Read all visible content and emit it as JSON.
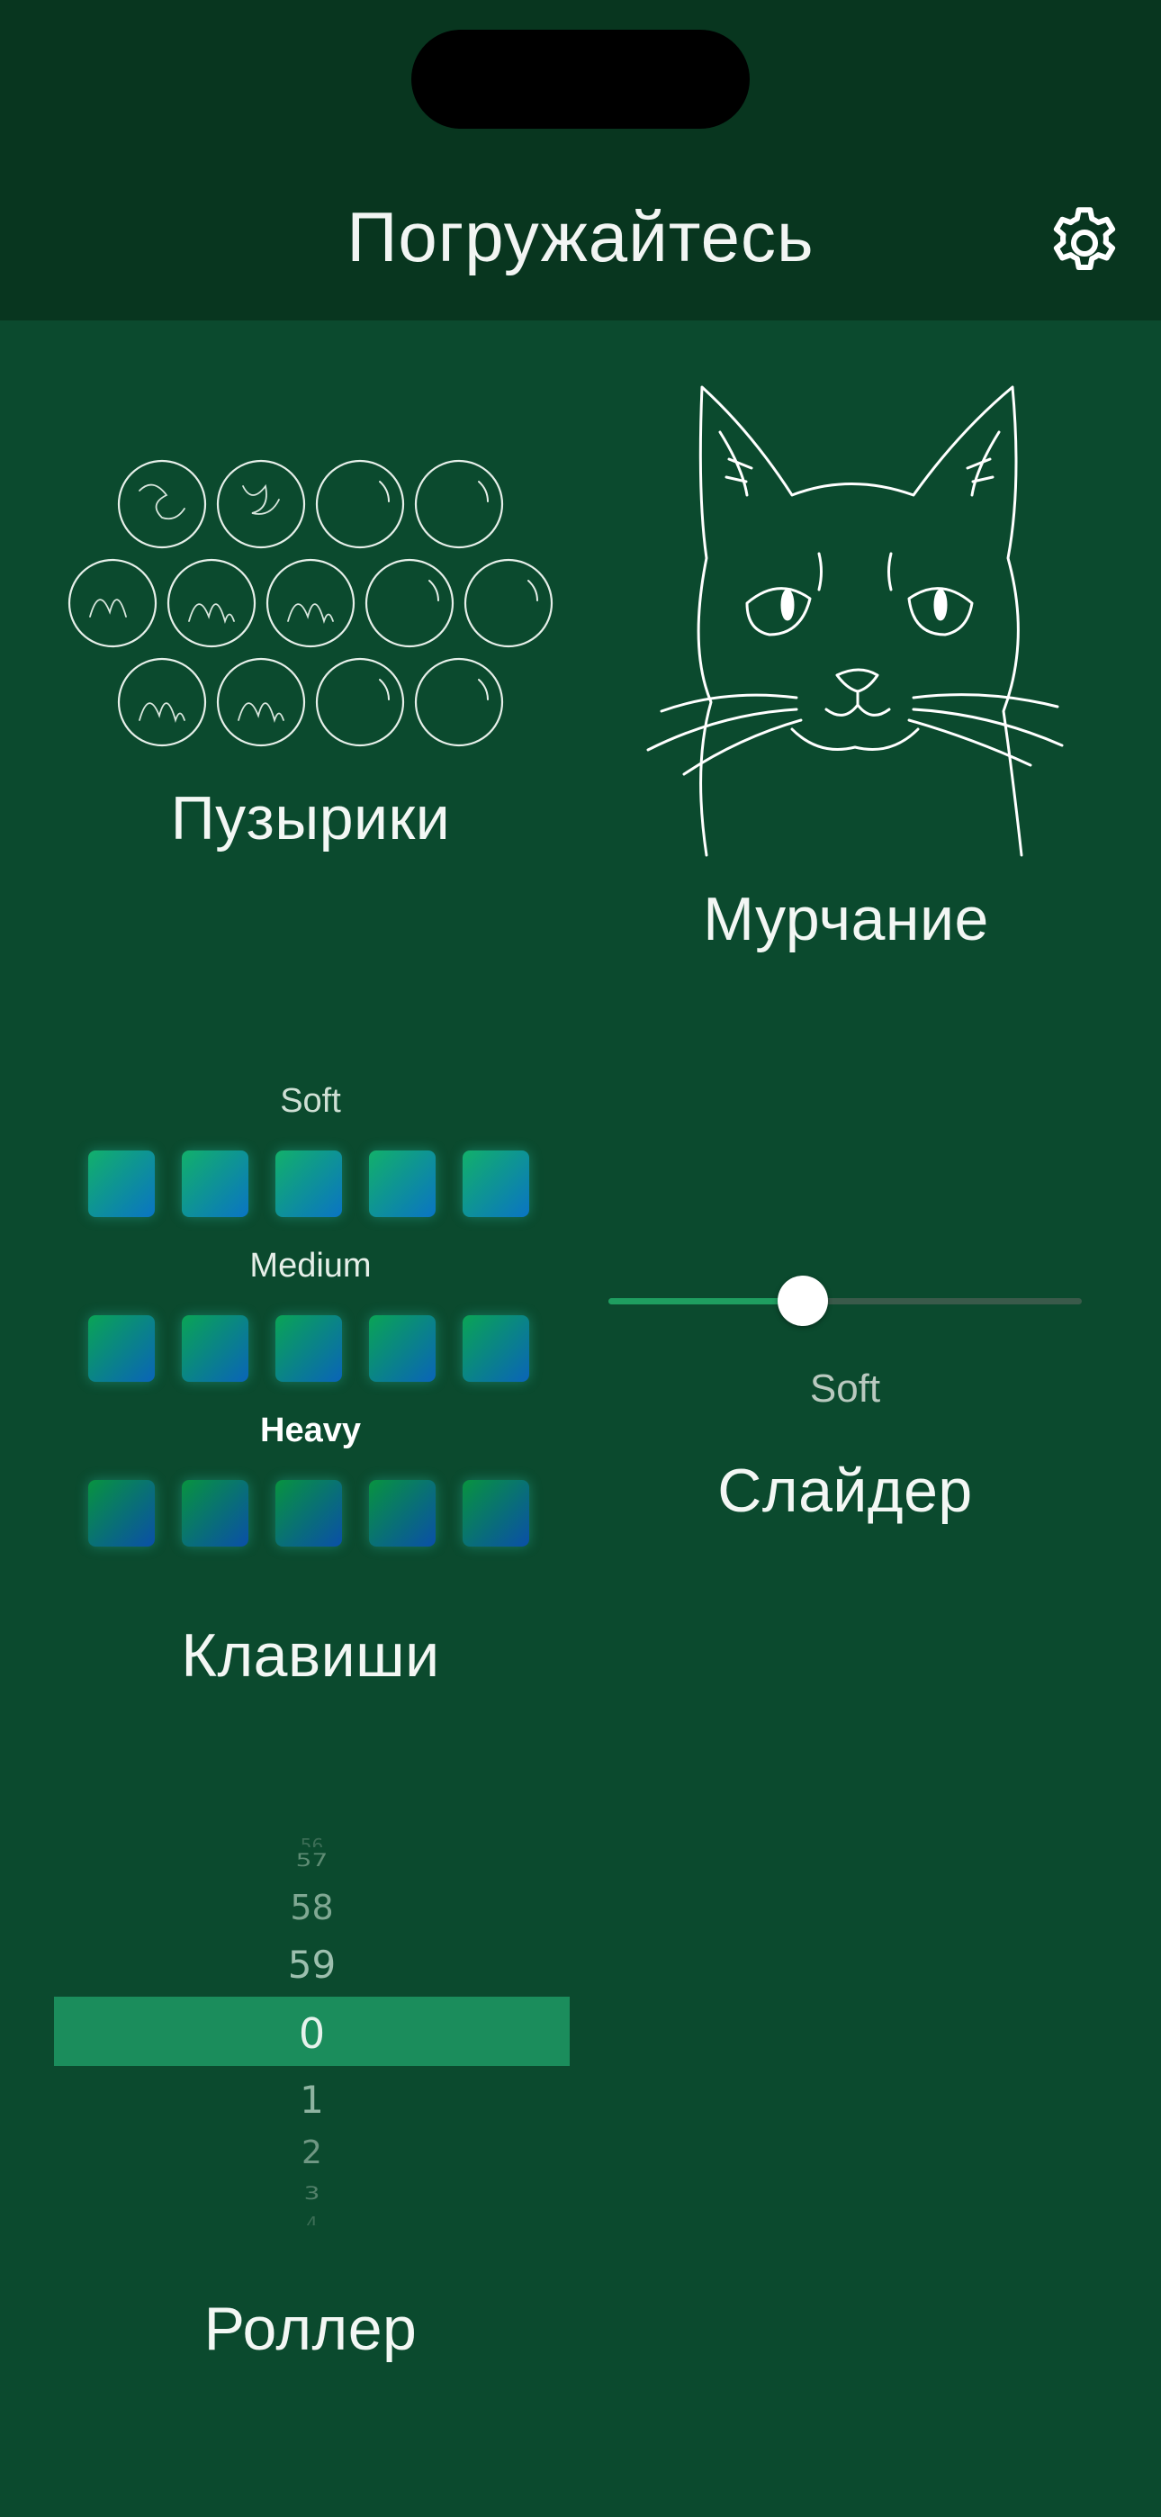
{
  "header": {
    "title": "Погружайтесь",
    "settings_icon": "gear-icon"
  },
  "cards": {
    "bubbles": {
      "label": "Пузырики",
      "icon": "bubble-wrap-icon"
    },
    "purr": {
      "label": "Мурчание",
      "icon": "cat-face-icon"
    },
    "keys": {
      "label": "Клавиши",
      "rows": [
        {
          "label": "Soft"
        },
        {
          "label": "Medium"
        },
        {
          "label": "Heavy"
        }
      ]
    },
    "slider": {
      "label": "Слайдер",
      "value_label": "Soft",
      "level": 0.41
    },
    "roller": {
      "label": "Роллер",
      "numbers": [
        "56",
        "57",
        "58",
        "59",
        "0",
        "1",
        "2",
        "3",
        "4"
      ],
      "selected": "0"
    }
  },
  "colors": {
    "background": "#0b4a2e",
    "header": "#08361f",
    "accent": "#1f9e60",
    "roller_band": "#1b8d5c"
  }
}
